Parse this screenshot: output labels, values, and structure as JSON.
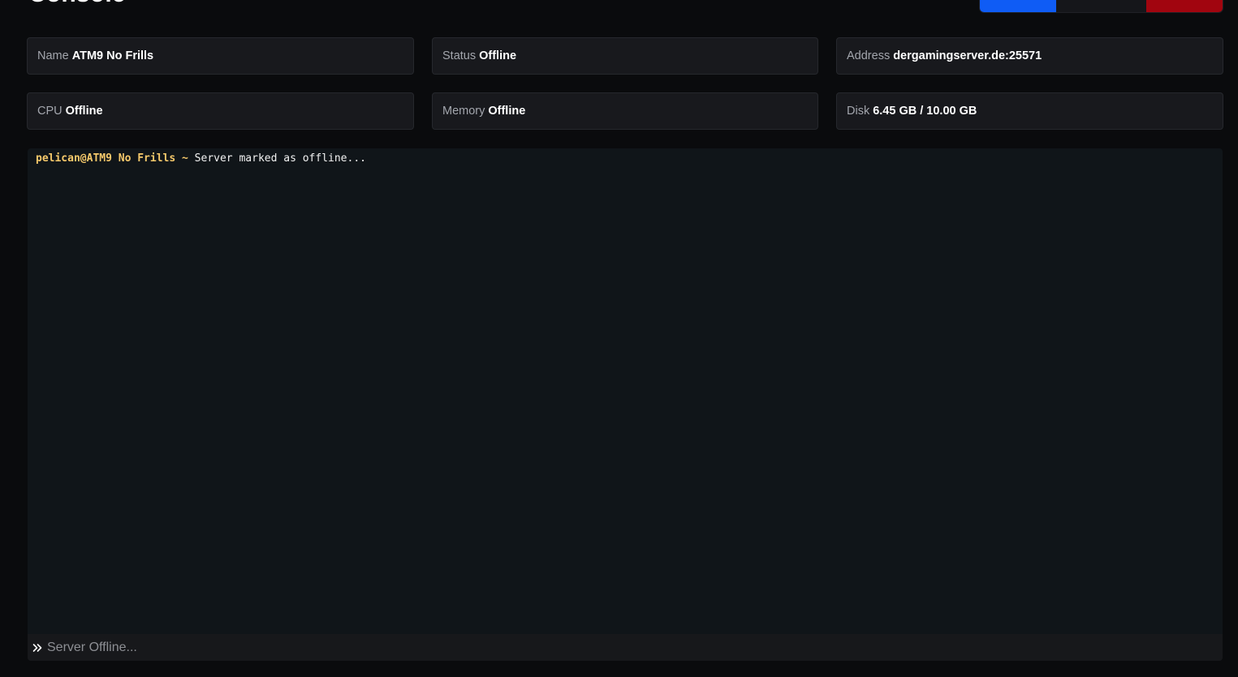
{
  "page": {
    "title": "Console"
  },
  "power": {
    "colors": {
      "start": "#0f5cf5",
      "restart": "#15161a",
      "stop": "#a1050f"
    }
  },
  "stats": {
    "name": {
      "label": "Name",
      "value": "ATM9 No Frills"
    },
    "status": {
      "label": "Status",
      "value": "Offline"
    },
    "address": {
      "label": "Address",
      "value": "dergamingserver.de:25571"
    },
    "cpu": {
      "label": "CPU",
      "value": "Offline"
    },
    "memory": {
      "label": "Memory",
      "value": "Offline"
    },
    "disk": {
      "label": "Disk",
      "value": "6.45 GB / 10.00 GB"
    }
  },
  "console": {
    "lines": [
      {
        "prompt": "pelican@ATM9 No Frills ~",
        "message": "Server marked as offline..."
      }
    ],
    "input": {
      "value": "",
      "placeholder": "Server Offline..."
    },
    "colors": {
      "prompt": "#f6c96b",
      "background": "#101519"
    }
  }
}
